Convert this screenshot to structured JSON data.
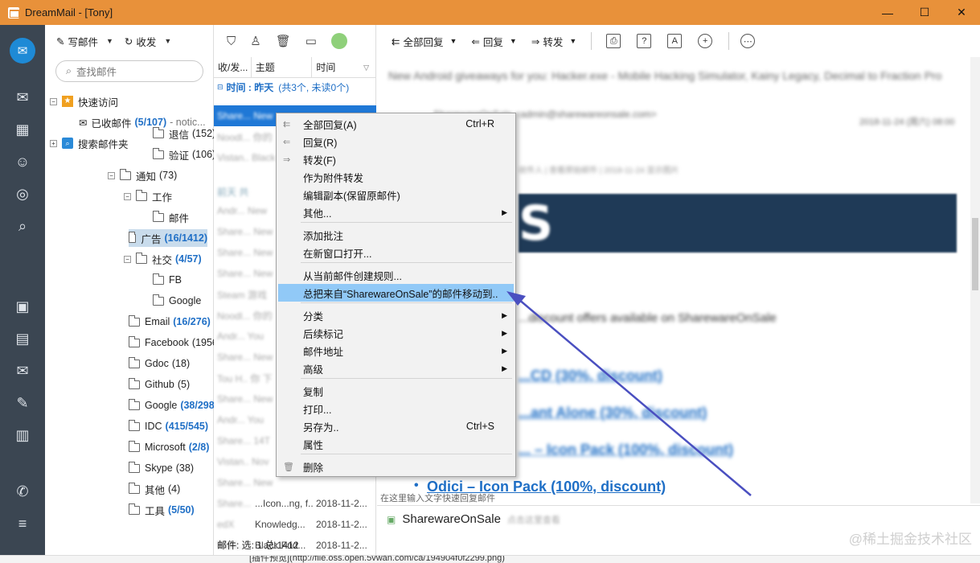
{
  "window": {
    "title": "DreamMail - [Tony]",
    "minimize": "—",
    "maximize": "☐",
    "close": "✕"
  },
  "folder_toolbar": {
    "compose": "写邮件",
    "receive": "收发",
    "search_placeholder": "查找邮件"
  },
  "tree": {
    "quick_access": "快速访问",
    "inbox": "已收邮件",
    "inbox_count": "(5/107)",
    "inbox_tail": "- notic...",
    "search_folders": "搜索邮件夹",
    "items": [
      {
        "label": "退信",
        "count": "(152)",
        "bold": false
      },
      {
        "label": "验证",
        "count": "(106)",
        "bold": false
      },
      {
        "label": "通知",
        "count": "(73)",
        "bold": false
      },
      {
        "label": "工作",
        "count": "",
        "bold": false
      },
      {
        "label": "邮件",
        "count": "",
        "bold": false
      },
      {
        "label": "广告",
        "count": "(16/1412)",
        "bold": true
      },
      {
        "label": "社交",
        "count": "(4/57)",
        "bold": true
      },
      {
        "label": "FB",
        "count": "",
        "bold": false
      },
      {
        "label": "Google",
        "count": "",
        "bold": false
      },
      {
        "label": "Email",
        "count": "(16/276)",
        "bold": true
      },
      {
        "label": "Facebook",
        "count": "(1956)",
        "bold": false
      },
      {
        "label": "Gdoc",
        "count": "(18)",
        "bold": false
      },
      {
        "label": "Github",
        "count": "(5)",
        "bold": false
      },
      {
        "label": "Google",
        "count": "(38/298)",
        "bold": true
      },
      {
        "label": "IDC",
        "count": "(415/545)",
        "bold": true
      },
      {
        "label": "Microsoft",
        "count": "(2/8)",
        "bold": true
      },
      {
        "label": "Skype",
        "count": "(38)",
        "bold": false
      },
      {
        "label": "其他",
        "count": "(4)",
        "bold": false
      },
      {
        "label": "工具",
        "count": "(5/50)",
        "bold": true
      }
    ]
  },
  "list": {
    "col_from": "收/发...",
    "col_subject": "主题",
    "col_time": "时间",
    "group_label": "时间 : 昨天",
    "group_detail": "(共3个, 未读0个)",
    "visible_rows": [
      {
        "from": "Share...",
        "subject": "...Icon...ng, f...",
        "time": "2018-11-2..."
      },
      {
        "from": "edX",
        "subject": "Knowledg...",
        "time": "2018-11-2..."
      },
      {
        "from": "Wurl...",
        "subject": "Black Frid...",
        "time": "2018-11-2..."
      }
    ],
    "status": "邮件: 选: 1  总:1412"
  },
  "read_toolbar": {
    "reply_all": "全部回复",
    "reply": "回复",
    "forward": "转发"
  },
  "message": {
    "subject_blur": "New Android giveaways for you: Hacker.exe - Mobile Hacking Simulator, Kainy Legacy, Decimal to Fraction Pro",
    "links": [
      "Odici – Icon Pack (100%, discount)"
    ],
    "quick_reply": "在这里输入文字快速回复邮件",
    "from": "SharewareOnSale"
  },
  "context_menu": {
    "items": [
      {
        "label": "全部回复(A)",
        "shortcut": "Ctrl+R",
        "sub": false
      },
      {
        "label": "回复(R)",
        "shortcut": "",
        "sub": false
      },
      {
        "label": "转发(F)",
        "shortcut": "",
        "sub": false
      },
      {
        "label": "作为附件转发",
        "shortcut": "",
        "sub": false
      },
      {
        "label": "编辑副本(保留原邮件)",
        "shortcut": "",
        "sub": false
      },
      {
        "label": "其他...",
        "shortcut": "",
        "sub": true
      },
      {
        "label": "添加批注",
        "shortcut": "",
        "sub": false
      },
      {
        "label": "在新窗口打开...",
        "shortcut": "",
        "sub": false
      },
      {
        "label": "从当前邮件创建规则...",
        "shortcut": "",
        "sub": false
      },
      {
        "label": "总把来自“SharewareOnSale”的邮件移动到..",
        "shortcut": "",
        "sub": false
      },
      {
        "label": "分类",
        "shortcut": "",
        "sub": true
      },
      {
        "label": "后续标记",
        "shortcut": "",
        "sub": true
      },
      {
        "label": "邮件地址",
        "shortcut": "",
        "sub": true
      },
      {
        "label": "高级",
        "shortcut": "",
        "sub": true
      },
      {
        "label": "复制",
        "shortcut": "",
        "sub": false
      },
      {
        "label": "打印...",
        "shortcut": "",
        "sub": false
      },
      {
        "label": "另存为..",
        "shortcut": "Ctrl+S",
        "sub": false
      },
      {
        "label": "属性",
        "shortcut": "",
        "sub": false
      },
      {
        "label": "删除",
        "shortcut": "",
        "sub": false
      }
    ]
  },
  "bottom_strip": "[插件预览](http://file.oss.open.5vwan.com/ca/194904f0f2299.png)",
  "watermark": "@稀土掘金技术社区",
  "colors": {
    "titlebar": "#e8913a",
    "nav": "#3b4652",
    "accent": "#1f6fc6",
    "highlight": "#91c9f7"
  }
}
